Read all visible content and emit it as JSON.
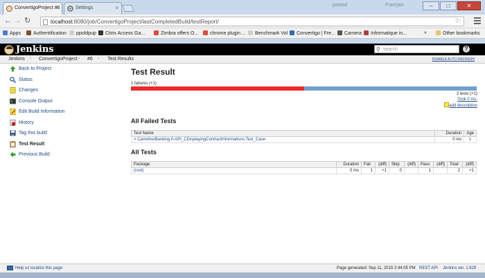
{
  "browser": {
    "tabs": [
      {
        "title": "ConvertigoProject #6"
      },
      {
        "title": "Settings"
      }
    ],
    "faint_left": "pasted",
    "faint_right": "Français",
    "window_controls": {
      "minimize": "–",
      "maximize": "□",
      "close": "✕"
    },
    "url_host": "localhost",
    "url_path": ":8080/job/ConvertigoProject/lastCompletedBuild/testReport/",
    "bookmarks": [
      {
        "label": "Apps"
      },
      {
        "label": "Authentification"
      },
      {
        "label": "ppoldpup"
      },
      {
        "label": "Citrix Access Ga..."
      },
      {
        "label": "Zimbra offers O..."
      },
      {
        "label": "chrome plugin ..."
      },
      {
        "label": "Benchmark Vol"
      },
      {
        "label": "Convertigo | Fre..."
      },
      {
        "label": "Camera"
      },
      {
        "label": "Informatique in..."
      }
    ],
    "other_bookmarks": "Other bookmarks",
    "chevron": "»"
  },
  "jenkins": {
    "logo_text": "Jenkins",
    "search_placeholder": "search",
    "help": "?",
    "breadcrumbs": [
      "Jenkins",
      "ConvertigoProject",
      "#6",
      "Test Results"
    ],
    "auto_refresh": "DISABLE AUTO REFRESH",
    "sidebar": [
      {
        "label": "Back to Project",
        "icon": "up-arrow-icon",
        "color": "#3a9e2e"
      },
      {
        "label": "Status",
        "icon": "magnifier-icon",
        "color": "#3465a4"
      },
      {
        "label": "Changes",
        "icon": "notepad-icon",
        "color": "#c4a000"
      },
      {
        "label": "Console Output",
        "icon": "terminal-icon",
        "color": "#2e3436"
      },
      {
        "label": "Edit Build Information",
        "icon": "notepad-pencil-icon",
        "color": "#c4a000"
      },
      {
        "label": "History",
        "icon": "history-icon",
        "color": "#cc0000"
      },
      {
        "label": "Tag this build",
        "icon": "save-icon",
        "color": "#204a87"
      },
      {
        "label": "Test Result",
        "icon": "clipboard-icon",
        "color": "#8f5902"
      },
      {
        "label": "Previous Build",
        "icon": "left-arrow-icon",
        "color": "#3a9e2e"
      }
    ],
    "test_result": {
      "title": "Test Result",
      "failures_text": "1 failures (+1)",
      "failure_fraction": 0.5,
      "tests_text": "2 tests (+1)",
      "took_text": "Took 0 ms.",
      "add_description": "add description",
      "failed_heading": "All Failed Tests",
      "failed_columns": [
        "Test Name",
        "Duration",
        "Age"
      ],
      "failed_rows": [
        {
          "toggle": "+",
          "name": "CarrefourBanking.0-API_CDisplayingContractInformations.Test_Case",
          "duration": "0 ms",
          "age": "1"
        }
      ],
      "all_heading": "All Tests",
      "all_columns": [
        "Package",
        "Duration",
        "Fail",
        "(diff)",
        "Skip",
        "(diff)",
        "Pass",
        "(diff)",
        "Total",
        "(diff)"
      ],
      "all_rows": [
        {
          "package": "(root)",
          "duration": "0 ms",
          "fail": "1",
          "fail_diff": "+1",
          "skip": "0",
          "skip_diff": "",
          "pass": "1",
          "pass_diff": "",
          "total": "2",
          "total_diff": "+1"
        }
      ]
    },
    "footer": {
      "localize": "Help us localize this page",
      "generated": "Page generated: Sep 11, 2015 2:44:05 PM",
      "rest_api": "REST API",
      "version": "Jenkins ver. 1.628"
    }
  }
}
